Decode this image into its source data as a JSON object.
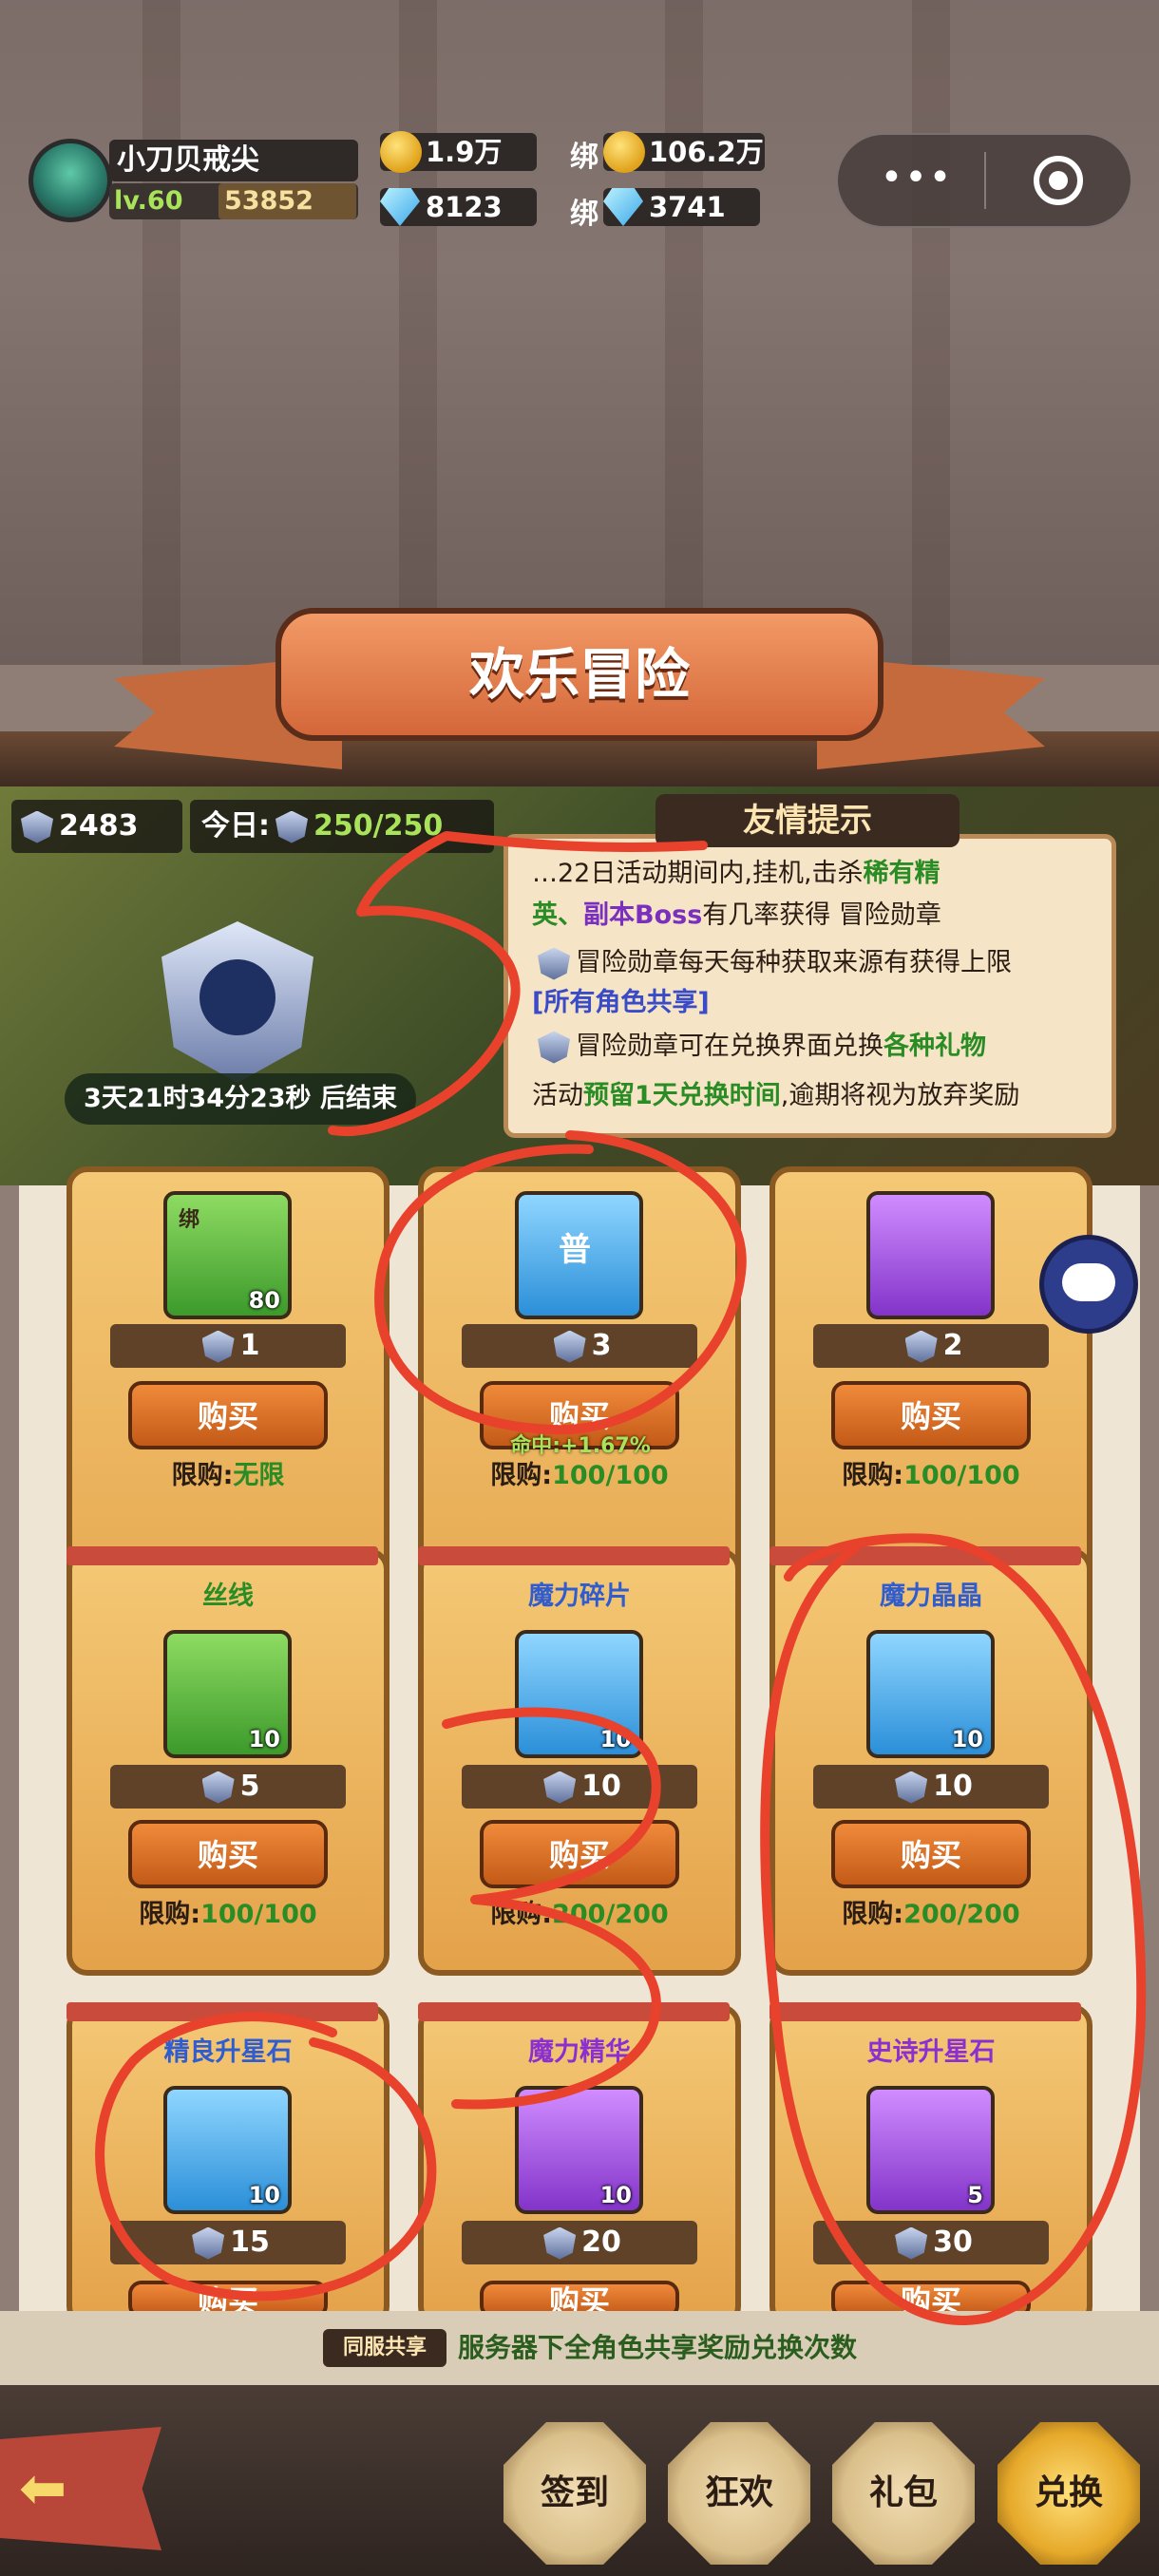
{
  "player": {
    "name": "小刀贝戒尖",
    "level": "lv.60",
    "power": "53852"
  },
  "currencies": {
    "gold": "1.9万",
    "bound_label": "绑",
    "bound_gold": "106.2万",
    "gem": "8123",
    "bound_gem": "3741"
  },
  "banner": {
    "title": "欢乐冒险"
  },
  "event": {
    "medal_total": "2483",
    "today_label": "今日:",
    "today_value": "250/250",
    "countdown": "3天21时34分23秒 后结束",
    "tip_title": "友情提示",
    "tips": [
      {
        "a": "…22日活动期间内,挂机,击杀",
        "b": "稀有精"
      },
      {
        "a": "英、",
        "b": "副本Boss",
        "c": "有几率获得 冒险勋章"
      },
      {
        "a": "冒险勋章每天每种获取来源有获得上限"
      },
      {
        "a": "[所有角色共享]"
      },
      {
        "a": "冒险勋章可在兑换界面兑换",
        "b": "各种礼物"
      },
      {
        "a": "活动",
        "b": "预留1天兑换时间",
        "c": ",逾期将视为放弃奖励"
      }
    ]
  },
  "shop": {
    "buy_label": "购买",
    "limit_label": "限购:",
    "items": [
      {
        "title": "",
        "icon": "bound-coin-icon",
        "qty": "80",
        "price": "1",
        "limit": "无限",
        "color": "green",
        "icon_text": "绑"
      },
      {
        "title": "",
        "icon": "scroll-icon",
        "qty": "",
        "price": "3",
        "limit": "100/100",
        "color": "blue",
        "icon_text": "普",
        "bonus": "命中:+1.67%"
      },
      {
        "title": "",
        "icon": "rune-icon",
        "qty": "",
        "price": "2",
        "limit": "100/100",
        "color": "purple",
        "icon_text": ""
      },
      {
        "title": "丝线",
        "icon": "thread-icon",
        "qty": "10",
        "price": "5",
        "limit": "100/100",
        "color": "green"
      },
      {
        "title": "魔力碎片",
        "icon": "crystal-shard-icon",
        "qty": "10",
        "price": "10",
        "limit": "200/200",
        "color": "blue"
      },
      {
        "title": "魔力晶晶",
        "icon": "crystal-icon",
        "qty": "10",
        "price": "10",
        "limit": "200/200",
        "color": "blue"
      },
      {
        "title": "精良升星石",
        "icon": "blue-star-stone-icon",
        "qty": "10",
        "price": "15",
        "limit": "",
        "color": "blue"
      },
      {
        "title": "魔力精华",
        "icon": "potion-icon",
        "qty": "10",
        "price": "20",
        "limit": "",
        "color": "purple"
      },
      {
        "title": "史诗升星石",
        "icon": "purple-star-stone-icon",
        "qty": "5",
        "price": "30",
        "limit": "",
        "color": "purple"
      }
    ]
  },
  "footer": {
    "share_tag": "同服共享",
    "share_text": "服务器下全角色共享奖励兑换次数",
    "nav": [
      "签到",
      "狂欢",
      "礼包",
      "兑换"
    ],
    "active_nav": "兑换"
  },
  "annotations": {
    "color": "#e8412c",
    "marks": [
      "5",
      "3"
    ]
  }
}
